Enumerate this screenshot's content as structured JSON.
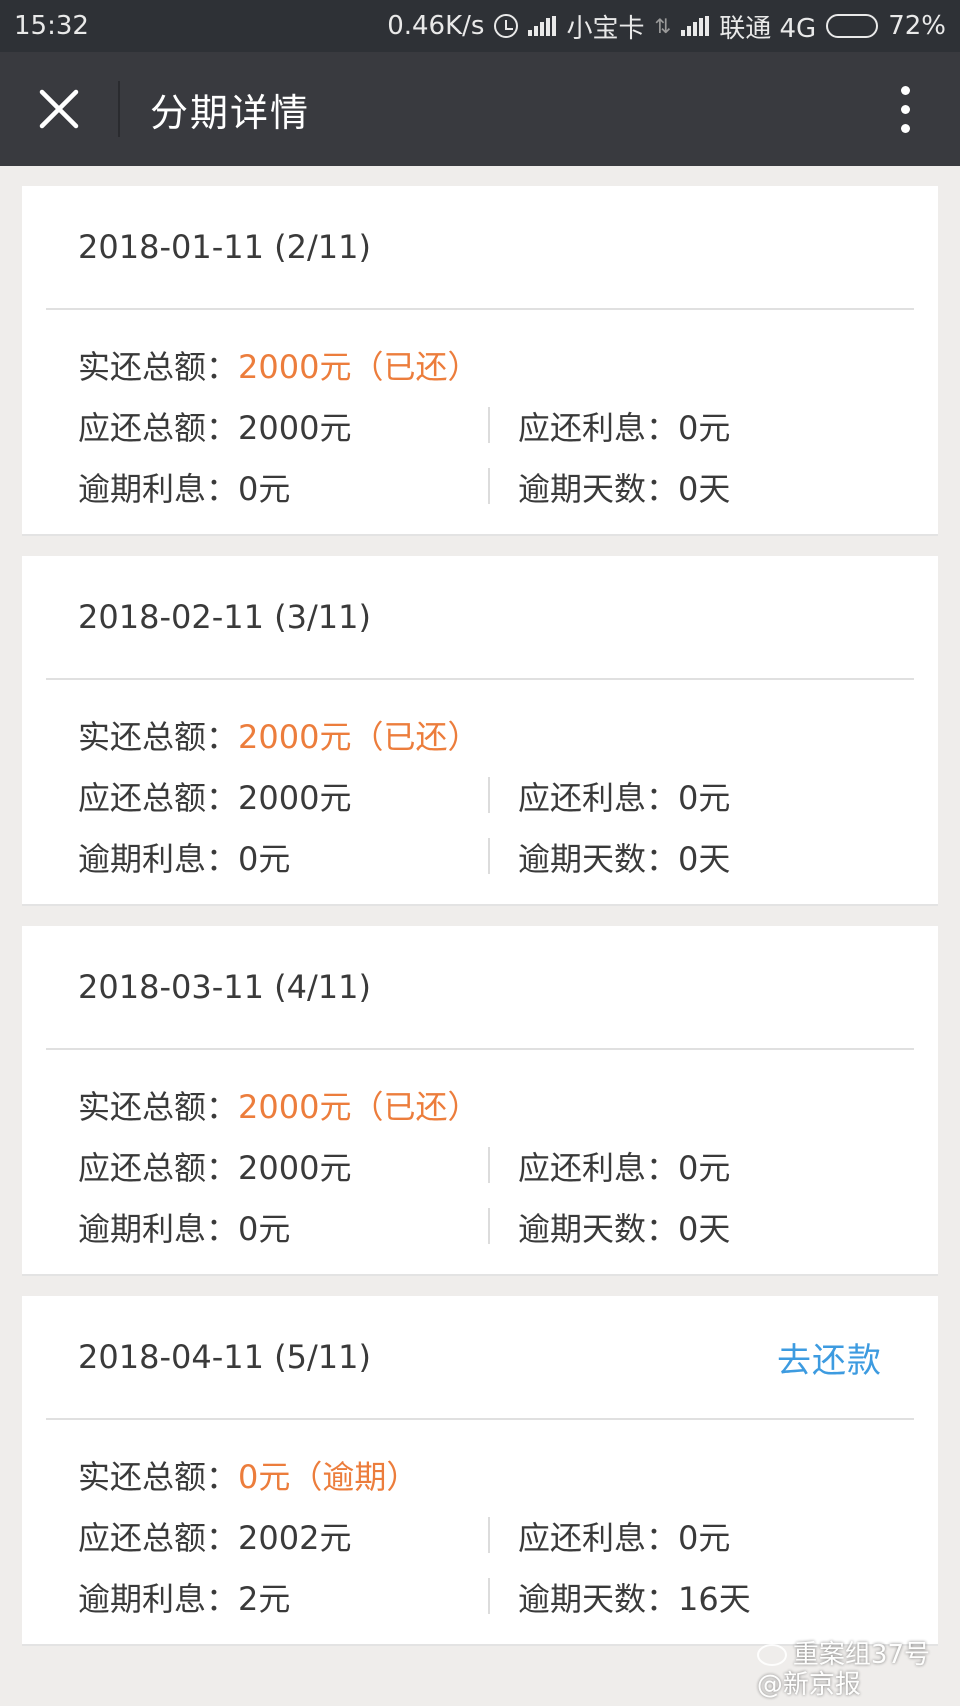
{
  "status_bar": {
    "time": "15:32",
    "speed": "0.46K/s",
    "carrier1": "小宝卡",
    "carrier2": "联通 4G",
    "battery": "72%",
    "battery_level": 0.72
  },
  "nav": {
    "title": "分期详情"
  },
  "labels": {
    "actual_total": "实还总额：",
    "due_total": "应还总额：",
    "due_interest": "应还利息：",
    "overdue_interest": "逾期利息：",
    "overdue_days": "逾期天数："
  },
  "accent_color": "#ec7d3c",
  "link_color": "#3d9be0",
  "installments": [
    {
      "date": "2018-01-11 (2/11)",
      "action": "",
      "actual_total": "2000元（已还）",
      "due_total": "2000元",
      "due_interest": "0元",
      "overdue_interest": "0元",
      "overdue_days": "0天"
    },
    {
      "date": "2018-02-11 (3/11)",
      "action": "",
      "actual_total": "2000元（已还）",
      "due_total": "2000元",
      "due_interest": "0元",
      "overdue_interest": "0元",
      "overdue_days": "0天"
    },
    {
      "date": "2018-03-11 (4/11)",
      "action": "",
      "actual_total": "2000元（已还）",
      "due_total": "2000元",
      "due_interest": "0元",
      "overdue_interest": "0元",
      "overdue_days": "0天"
    },
    {
      "date": "2018-04-11 (5/11)",
      "action": "去还款",
      "actual_total": "0元（逾期）",
      "due_total": "2002元",
      "due_interest": "0元",
      "overdue_interest": "2元",
      "overdue_days": "16天"
    }
  ],
  "watermark": {
    "line1": "重案组37号",
    "line2": "@新京报"
  }
}
